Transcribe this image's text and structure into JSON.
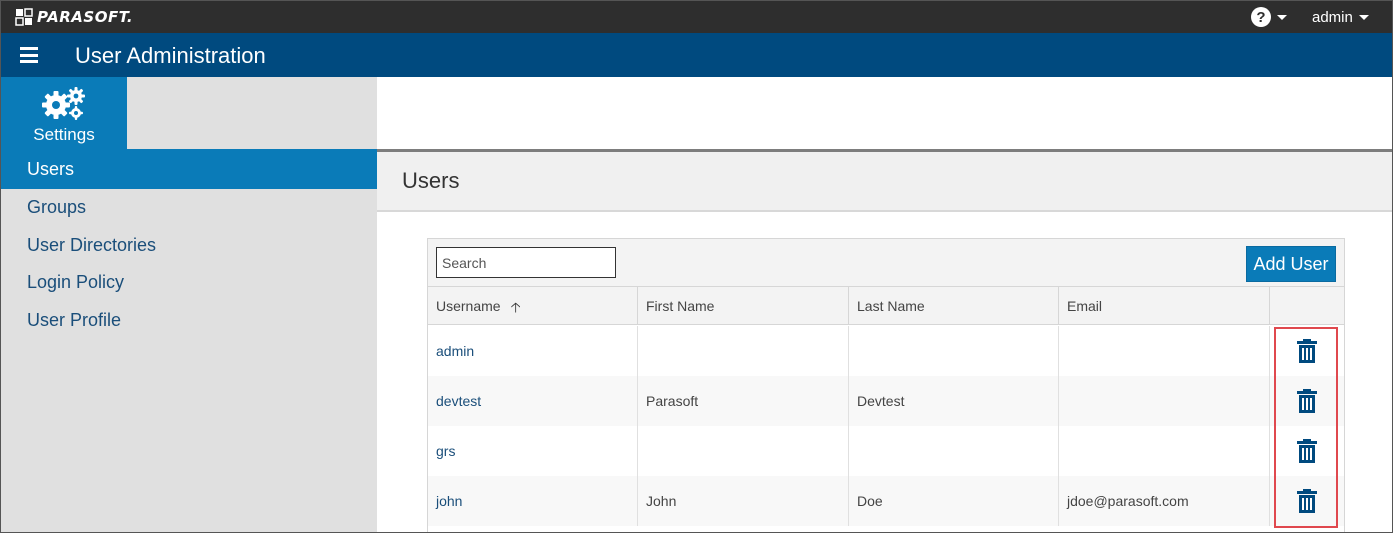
{
  "topbar": {
    "logo_text": "PARASOFT.",
    "help_icon": "question-circle-icon",
    "user_label": "admin"
  },
  "header": {
    "menu_icon": "hamburger-icon",
    "title": "User Administration"
  },
  "sidebar": {
    "settings_label": "Settings",
    "settings_icon": "gears-icon",
    "items": [
      {
        "label": "Users",
        "active": true
      },
      {
        "label": "Groups",
        "active": false
      },
      {
        "label": "User Directories",
        "active": false
      },
      {
        "label": "Login Policy",
        "active": false
      },
      {
        "label": "User Profile",
        "active": false
      }
    ]
  },
  "main": {
    "section_title": "Users",
    "search": {
      "placeholder": "Search",
      "value": ""
    },
    "add_user_label": "Add User",
    "columns": [
      "Username",
      "First Name",
      "Last Name",
      "Email"
    ],
    "sort_column": "Username",
    "sort_icon": "arrow-up-icon",
    "delete_icon": "trash-icon",
    "rows": [
      {
        "username": "admin",
        "first_name": "",
        "last_name": "",
        "email": ""
      },
      {
        "username": "devtest",
        "first_name": "Parasoft",
        "last_name": "Devtest",
        "email": ""
      },
      {
        "username": "grs",
        "first_name": "",
        "last_name": "",
        "email": ""
      },
      {
        "username": "john",
        "first_name": "John",
        "last_name": "Doe",
        "email": "jdoe@parasoft.com"
      }
    ]
  },
  "colors": {
    "topbar": "#2e2e2e",
    "header": "#004a7f",
    "accent": "#0a7bb8",
    "sidebar": "#e0e0e0",
    "link": "#1a4e7a",
    "highlight": "#e0484e"
  }
}
